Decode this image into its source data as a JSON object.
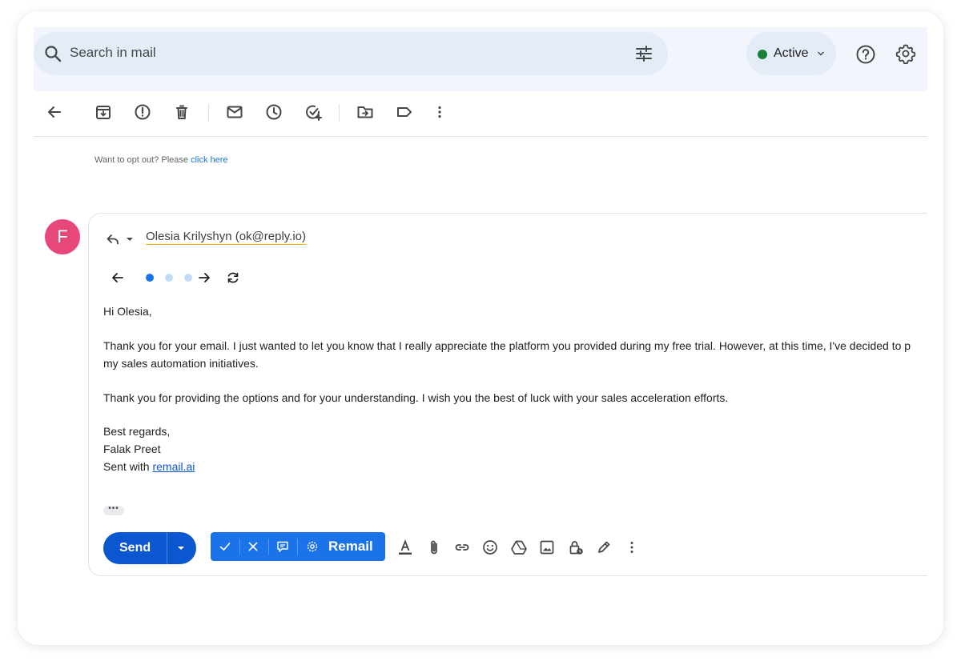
{
  "search": {
    "placeholder": "Search in mail",
    "icon": "search-icon",
    "filter_icon": "tune-icon"
  },
  "status": {
    "label": "Active",
    "color": "#188038"
  },
  "toolbar": {
    "icons": [
      "back-arrow-icon",
      "archive-icon",
      "report-spam-icon",
      "delete-icon",
      "mark-unread-icon",
      "snooze-icon",
      "add-task-icon",
      "move-to-icon",
      "label-icon",
      "more-vert-icon"
    ]
  },
  "optout": {
    "text": "Want to opt out? Please",
    "link": "click here"
  },
  "message": {
    "avatar_letter": "F",
    "avatar_color": "#e8477a",
    "recipient": "Olesia Krilyshyn (ok@reply.io)",
    "body": {
      "greeting": "Hi Olesia,",
      "para1_line1": "Thank you for your email. I just wanted to let you know that I really appreciate the platform you provided during my free trial. However, at this time, I've decided to p",
      "para1_line2": "my sales automation initiatives.",
      "para2": "Thank you for providing the options and for your understanding. I wish you the best of luck with your sales acceleration efforts.",
      "signoff": "Best regards,",
      "name": "Falak Preet",
      "sent_with": "Sent with",
      "sent_link": "remail.ai"
    },
    "ellipsis": "•••"
  },
  "compose_actions": {
    "send_label": "Send",
    "send_color": "#0b57d0",
    "remail_label": "Remail",
    "remail_color": "#1a73e8"
  }
}
